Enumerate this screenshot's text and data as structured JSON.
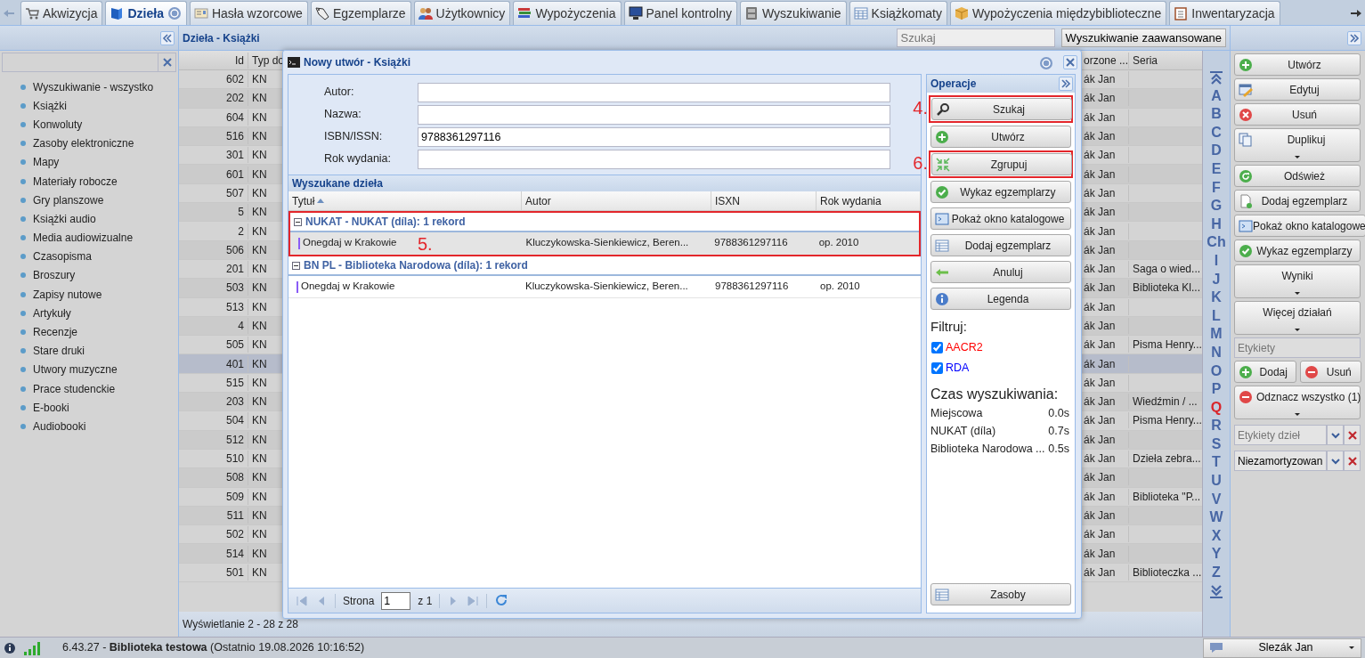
{
  "tabs": [
    {
      "label": "Akwizycja",
      "selected": false
    },
    {
      "label": "Dzieła",
      "selected": true
    },
    {
      "label": "Hasła wzorcowe",
      "selected": false
    },
    {
      "label": "Egzemplarze",
      "selected": false
    },
    {
      "label": "Użytkownicy",
      "selected": false
    },
    {
      "label": "Wypożyczenia",
      "selected": false
    },
    {
      "label": "Panel kontrolny",
      "selected": false
    },
    {
      "label": "Wyszukiwanie",
      "selected": false
    },
    {
      "label": "Książkomaty",
      "selected": false
    },
    {
      "label": "Wypożyczenia międzybiblioteczne",
      "selected": false
    },
    {
      "label": "Inwentaryzacja",
      "selected": false
    }
  ],
  "sidebar": {
    "items": [
      "Wyszukiwanie - wszystko",
      "Książki",
      "Konwoluty",
      "Zasoby elektroniczne",
      "Mapy",
      "Materiały robocze",
      "Gry planszowe",
      "Książki audio",
      "Media audiowizualne",
      "Czasopisma",
      "Broszury",
      "Zapisy nutowe",
      "Artykuły",
      "Recenzje",
      "Stare druki",
      "Utwory muzyczne",
      "Prace studenckie",
      "E-booki",
      "Audiobooki"
    ]
  },
  "list_title": "Dzieła - Książki",
  "search": {
    "placeholder": "Szukaj"
  },
  "advanced_search": "Wyszukiwanie zaawansowane",
  "table": {
    "columns": [
      "Id",
      "Typ do",
      "orzone ...",
      "Seria"
    ],
    "rows": [
      {
        "id": "602",
        "type": "KN",
        "created": "ák Jan",
        "selected": false
      },
      {
        "id": "202",
        "type": "KN",
        "created": "ák Jan",
        "selected": false
      },
      {
        "id": "604",
        "type": "KN",
        "created": "ák Jan",
        "selected": false
      },
      {
        "id": "516",
        "type": "KN",
        "created": "ák Jan",
        "selected": false
      },
      {
        "id": "301",
        "type": "KN",
        "created": "ák Jan",
        "selected": false
      },
      {
        "id": "601",
        "type": "KN",
        "created": "ák Jan",
        "selected": false
      },
      {
        "id": "507",
        "type": "KN",
        "created": "ák Jan",
        "selected": false
      },
      {
        "id": "5",
        "type": "KN",
        "created": "ák Jan",
        "selected": false
      },
      {
        "id": "2",
        "type": "KN",
        "created": "ák Jan",
        "selected": false
      },
      {
        "id": "506",
        "type": "KN",
        "created": "ák Jan",
        "selected": false
      },
      {
        "id": "201",
        "type": "KN",
        "created": "ák Jan",
        "series": "Saga o wied...",
        "selected": false
      },
      {
        "id": "503",
        "type": "KN",
        "created": "ák Jan",
        "series": "Biblioteka Kl...",
        "selected": false
      },
      {
        "id": "513",
        "type": "KN",
        "created": "ák Jan",
        "selected": false
      },
      {
        "id": "4",
        "type": "KN",
        "created": "ák Jan",
        "selected": false
      },
      {
        "id": "505",
        "type": "KN",
        "created": "ák Jan",
        "series": "Pisma Henry...",
        "selected": false
      },
      {
        "id": "401",
        "type": "KN",
        "created": "ák Jan",
        "selected": true
      },
      {
        "id": "515",
        "type": "KN",
        "created": "ák Jan",
        "selected": false
      },
      {
        "id": "203",
        "type": "KN",
        "created": "ák Jan",
        "series": "Wiedźmin / ...",
        "selected": false
      },
      {
        "id": "504",
        "type": "KN",
        "created": "ák Jan",
        "series": "Pisma Henry...",
        "selected": false
      },
      {
        "id": "512",
        "type": "KN",
        "created": "ák Jan",
        "selected": false
      },
      {
        "id": "510",
        "type": "KN",
        "created": "ák Jan",
        "series": "Dzieła zebra...",
        "selected": false
      },
      {
        "id": "508",
        "type": "KN",
        "created": "ák Jan",
        "selected": false
      },
      {
        "id": "509",
        "type": "KN",
        "created": "ák Jan",
        "series": "Biblioteka \"P...",
        "selected": false
      },
      {
        "id": "511",
        "type": "KN",
        "created": "ák Jan",
        "selected": false
      },
      {
        "id": "502",
        "type": "KN",
        "created": "ák Jan",
        "selected": false
      },
      {
        "id": "514",
        "type": "KN",
        "created": "ák Jan",
        "selected": false
      },
      {
        "id": "501",
        "type": "KN",
        "created": "ák Jan",
        "series": "Biblioteczka ...",
        "selected": false
      }
    ]
  },
  "footer": "Wyświetlanie 2 - 28 z 28",
  "alphabet": [
    {
      "letter": "A",
      "highlighted": false
    },
    {
      "letter": "B",
      "highlighted": false
    },
    {
      "letter": "C",
      "highlighted": false
    },
    {
      "letter": "D",
      "highlighted": false
    },
    {
      "letter": "E",
      "highlighted": false
    },
    {
      "letter": "F",
      "highlighted": false
    },
    {
      "letter": "G",
      "highlighted": false
    },
    {
      "letter": "H",
      "highlighted": false
    },
    {
      "letter": "Ch",
      "highlighted": false
    },
    {
      "letter": "I",
      "highlighted": false
    },
    {
      "letter": "J",
      "highlighted": false
    },
    {
      "letter": "K",
      "highlighted": false
    },
    {
      "letter": "L",
      "highlighted": false
    },
    {
      "letter": "M",
      "highlighted": false
    },
    {
      "letter": "N",
      "highlighted": false
    },
    {
      "letter": "O",
      "highlighted": false
    },
    {
      "letter": "P",
      "highlighted": false
    },
    {
      "letter": "Q",
      "highlighted": true
    },
    {
      "letter": "R",
      "highlighted": false
    },
    {
      "letter": "S",
      "highlighted": false
    },
    {
      "letter": "T",
      "highlighted": false
    },
    {
      "letter": "U",
      "highlighted": false
    },
    {
      "letter": "V",
      "highlighted": false
    },
    {
      "letter": "W",
      "highlighted": false
    },
    {
      "letter": "X",
      "highlighted": false
    },
    {
      "letter": "Y",
      "highlighted": false
    },
    {
      "letter": "Z",
      "highlighted": false
    }
  ],
  "actions": [
    {
      "label": "Utwórz",
      "dropdown": false
    },
    {
      "label": "Edytuj",
      "dropdown": false
    },
    {
      "label": "Usuń",
      "dropdown": false
    },
    {
      "label": "Duplikuj",
      "dropdown": true
    },
    {
      "label": "Odśwież",
      "dropdown": false
    },
    {
      "label": "Dodaj egzemplarz",
      "dropdown": false
    },
    {
      "label": "Pokaż okno katalogowe",
      "dropdown": false
    },
    {
      "label": "Wykaz egzemplarzy",
      "dropdown": false
    },
    {
      "label": "Wyniki",
      "dropdown": true
    },
    {
      "label": "Więcej działań",
      "dropdown": true
    }
  ],
  "labels_field": {
    "placeholder": "Etykiety"
  },
  "label_buttons": [
    "Dodaj",
    "Usuń"
  ],
  "unselect_button": "Odznacz wszystko (1)",
  "label_filters": [
    {
      "placeholder": "Etykiety dzieł"
    },
    {
      "value": "Niezamortyzowan"
    }
  ],
  "status_bar": {
    "version": "6.43.27 - **Biblioteka testowa** (Ostatnio 19.08.2026 10:16:52)",
    "user": "Slezák Jan"
  },
  "dialog": {
    "title": "Nowy utwór - Książki",
    "fields": [
      {
        "label": "Autor:"
      },
      {
        "label": "Nazwa:"
      },
      {
        "label": "ISBN/ISSN:",
        "value": "9788361297116"
      },
      {
        "label": "Rok wydania:"
      }
    ],
    "results_title": "Wyszukane dzieła",
    "columns": [
      {
        "label": "Tytuł",
        "sorted": true
      },
      {
        "label": "Autor",
        "sorted": false
      },
      {
        "label": "ISXN",
        "sorted": false
      },
      {
        "label": "Rok wydania",
        "sorted": false
      }
    ],
    "groups": [
      {
        "title": "NUKAT - NUKAT (díla): 1 rekord",
        "expanded": true,
        "callout": "5.",
        "rows": [
          {
            "title": "Onegdaj w Krakowie",
            "author": "Kluczykowska-Sienkiewicz, Beren...",
            "isxn": "9788361297116",
            "year": "op. 2010",
            "selected": true
          }
        ]
      },
      {
        "title": "BN PL - Biblioteka Narodowa (díla): 1 rekord",
        "expanded": true,
        "rows": [
          {
            "title": "Onegdaj w Krakowie",
            "author": "Kluczykowska-Sienkiewicz, Beren...",
            "isxn": "9788361297116",
            "year": "op. 2010",
            "selected": false
          }
        ]
      }
    ],
    "pager": {
      "label": "Strona",
      "page": "1",
      "total": "z 1"
    },
    "operations": {
      "title": "Operacje",
      "buttons": [
        {
          "label": "Szukaj",
          "callout": "4."
        },
        {
          "label": "Utwórz"
        },
        {
          "label": "Zgrupuj",
          "callout": "6."
        },
        {
          "label": "Wykaz egzemplarzy"
        },
        {
          "label": "Pokaż okno katalogowe"
        },
        {
          "label": "Dodaj egzemplarz"
        },
        {
          "label": "Anuluj"
        },
        {
          "label": "Legenda"
        }
      ],
      "filter_title": "Filtruj:",
      "filters": [
        {
          "label": "AACR2",
          "checked": true,
          "color": "#ff0000"
        },
        {
          "label": "RDA",
          "checked": true,
          "color": "#0000ff"
        }
      ],
      "timing_title": "Czas wyszukiwania:",
      "timings": [
        {
          "source": "Miejscowa",
          "time": "0.0s"
        },
        {
          "source": "NUKAT (díla)",
          "time": "0.7s"
        },
        {
          "source": "Biblioteka Narodowa ...",
          "time": "0.5s"
        }
      ],
      "bottom_button": "Zasoby"
    }
  }
}
